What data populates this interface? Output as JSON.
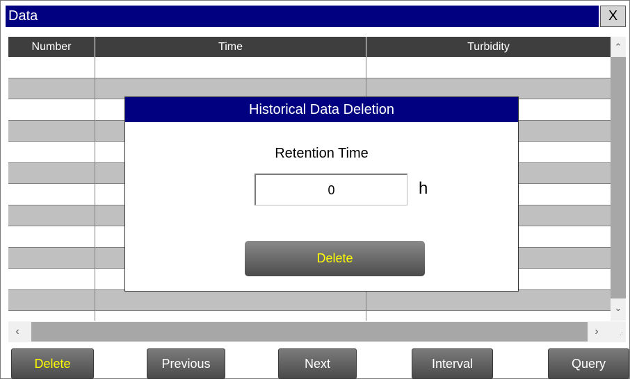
{
  "window": {
    "title": "Data",
    "close_label": "X"
  },
  "table": {
    "columns": [
      "Number",
      "Time",
      "Turbidity"
    ]
  },
  "dialog": {
    "title": "Historical Data Deletion",
    "retention_label": "Retention Time",
    "retention_value": "0",
    "unit": "h",
    "delete_label": "Delete"
  },
  "toolbar": {
    "delete_label": "Delete",
    "previous_label": "Previous",
    "next_label": "Next",
    "interval_label": "Interval",
    "query_label": "Query"
  },
  "scrollbars": {
    "up_icon": "^",
    "down_icon": "v",
    "left_icon": "<",
    "right_icon": ">"
  },
  "colors": {
    "titlebar": "#000080",
    "accent_text": "#ffff00",
    "header_bg": "#3e3e3e",
    "row_alt": "#c0c0c0"
  }
}
